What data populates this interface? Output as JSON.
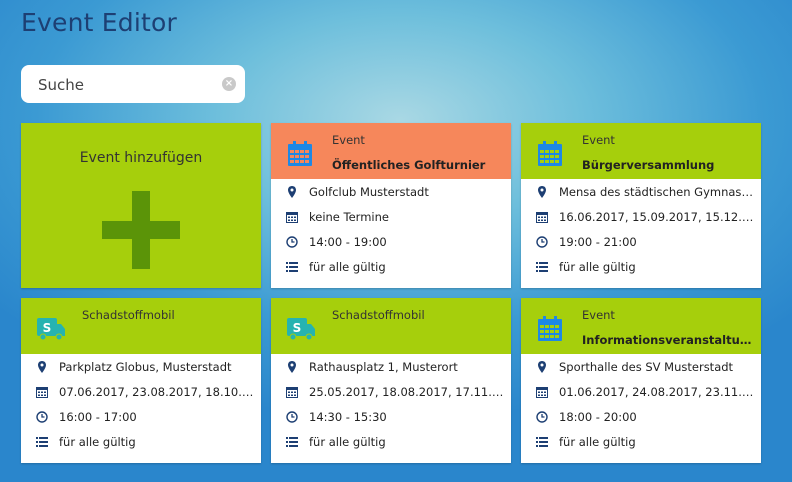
{
  "app": {
    "title": "Event Editor"
  },
  "search": {
    "placeholder": "Suche",
    "value": ""
  },
  "add_tile": {
    "label": "Event hinzufügen"
  },
  "colors": {
    "green": "#a6cf0c",
    "orange": "#f6875b",
    "plus": "#5b9408",
    "calendar_icon": "#1e88e5",
    "truck_icon": "#26b3b0"
  },
  "cards": [
    {
      "type": "Event",
      "name": "Öffentliches Golfturnier",
      "icon": "calendar-icon",
      "header_color": "orange",
      "location": "Golfclub Musterstadt",
      "dates": "keine Termine",
      "time": "14:00 - 19:00",
      "validity": "für alle gültig"
    },
    {
      "type": "Event",
      "name": "Bürgerversammlung",
      "icon": "calendar-icon",
      "header_color": "green",
      "location": "Mensa des städtischen Gymnasi...",
      "dates": "16.06.2017, 15.09.2017, 15.12.20...",
      "time": "19:00 - 21:00",
      "validity": "für alle gültig"
    },
    {
      "type": "Schadstoffmobil",
      "name": "",
      "icon": "truck-icon",
      "header_color": "green",
      "location": "Parkplatz Globus, Musterstadt",
      "dates": "07.06.2017, 23.08.2017, 18.10.20...",
      "time": "16:00 - 17:00",
      "validity": "für alle gültig"
    },
    {
      "type": "Schadstoffmobil",
      "name": "",
      "icon": "truck-icon",
      "header_color": "green",
      "location": "Rathausplatz 1, Musterort",
      "dates": "25.05.2017, 18.08.2017, 17.11.20...",
      "time": "14:30 - 15:30",
      "validity": "für alle gültig"
    },
    {
      "type": "Event",
      "name": "Informationsveranstaltung...",
      "icon": "calendar-icon",
      "header_color": "green",
      "location": "Sporthalle des SV Musterstadt",
      "dates": "01.06.2017, 24.08.2017, 23.11.20...",
      "time": "18:00 - 20:00",
      "validity": "für alle gültig"
    }
  ],
  "truck_letter": "S"
}
